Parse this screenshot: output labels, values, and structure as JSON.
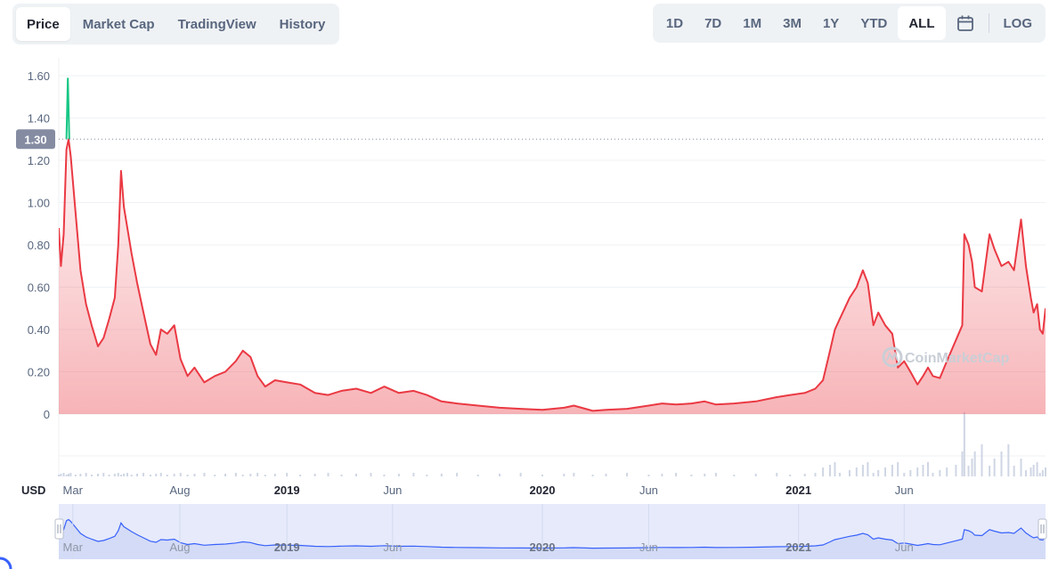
{
  "tabs": [
    {
      "label": "Price",
      "active": true
    },
    {
      "label": "Market Cap",
      "active": false
    },
    {
      "label": "TradingView",
      "active": false
    },
    {
      "label": "History",
      "active": false
    }
  ],
  "ranges": [
    {
      "label": "1D",
      "active": false
    },
    {
      "label": "7D",
      "active": false
    },
    {
      "label": "1M",
      "active": false
    },
    {
      "label": "3M",
      "active": false
    },
    {
      "label": "1Y",
      "active": false
    },
    {
      "label": "YTD",
      "active": false
    },
    {
      "label": "ALL",
      "active": true
    }
  ],
  "calendar_icon": "calendar-icon",
  "log_label": "LOG",
  "currency_label": "USD",
  "watermark": "CoinMarketCap",
  "colors": {
    "down": "#ea3943",
    "up": "#16c784",
    "navigator_line": "#3861fb",
    "navigator_fill": "#e6eafb",
    "volume": "#cfd6e4"
  },
  "chart_data": {
    "type": "area",
    "ylim": [
      0,
      1.7
    ],
    "yticks": [
      "0",
      "0.20",
      "0.40",
      "0.60",
      "0.80",
      "1.00",
      "1.20",
      "1.40",
      "1.60"
    ],
    "ytick_values": [
      0,
      0.2,
      0.4,
      0.6,
      0.8,
      1.0,
      1.2,
      1.4,
      1.6
    ],
    "current_price": 1.3,
    "current_price_label": "1.30",
    "xlim": [
      "2018-02-09",
      "2021-12-20"
    ],
    "xticks": [
      {
        "label": "Mar",
        "date": "2018-03-01",
        "bold": false
      },
      {
        "label": "Aug",
        "date": "2018-08-01",
        "bold": false
      },
      {
        "label": "2019",
        "date": "2019-01-01",
        "bold": true
      },
      {
        "label": "Jun",
        "date": "2019-06-01",
        "bold": false
      },
      {
        "label": "2020",
        "date": "2020-01-01",
        "bold": true
      },
      {
        "label": "Jun",
        "date": "2020-06-01",
        "bold": false
      },
      {
        "label": "2021",
        "date": "2021-01-01",
        "bold": true
      },
      {
        "label": "Jun",
        "date": "2021-06-01",
        "bold": false
      }
    ],
    "series": [
      {
        "points": [
          [
            "2018-02-09",
            0.88
          ],
          [
            "2018-02-12",
            0.7
          ],
          [
            "2018-02-16",
            0.85
          ],
          [
            "2018-02-20",
            1.25
          ],
          [
            "2018-02-23",
            1.3
          ],
          [
            "2018-02-26",
            1.22
          ],
          [
            "2018-03-05",
            0.95
          ],
          [
            "2018-03-12",
            0.68
          ],
          [
            "2018-03-20",
            0.52
          ],
          [
            "2018-03-28",
            0.42
          ],
          [
            "2018-04-06",
            0.32
          ],
          [
            "2018-04-14",
            0.36
          ],
          [
            "2018-04-22",
            0.45
          ],
          [
            "2018-04-30",
            0.55
          ],
          [
            "2018-05-05",
            0.8
          ],
          [
            "2018-05-09",
            1.15
          ],
          [
            "2018-05-13",
            0.98
          ],
          [
            "2018-05-18",
            0.88
          ],
          [
            "2018-05-24",
            0.76
          ],
          [
            "2018-06-01",
            0.62
          ],
          [
            "2018-06-10",
            0.48
          ],
          [
            "2018-06-20",
            0.33
          ],
          [
            "2018-06-28",
            0.28
          ],
          [
            "2018-07-05",
            0.4
          ],
          [
            "2018-07-14",
            0.38
          ],
          [
            "2018-07-24",
            0.42
          ],
          [
            "2018-08-02",
            0.26
          ],
          [
            "2018-08-12",
            0.18
          ],
          [
            "2018-08-22",
            0.22
          ],
          [
            "2018-09-05",
            0.15
          ],
          [
            "2018-09-20",
            0.18
          ],
          [
            "2018-10-05",
            0.2
          ],
          [
            "2018-10-20",
            0.25
          ],
          [
            "2018-10-30",
            0.3
          ],
          [
            "2018-11-10",
            0.27
          ],
          [
            "2018-11-20",
            0.18
          ],
          [
            "2018-12-01",
            0.13
          ],
          [
            "2018-12-15",
            0.16
          ],
          [
            "2019-01-01",
            0.15
          ],
          [
            "2019-01-20",
            0.14
          ],
          [
            "2019-02-10",
            0.1
          ],
          [
            "2019-03-01",
            0.09
          ],
          [
            "2019-03-20",
            0.11
          ],
          [
            "2019-04-10",
            0.12
          ],
          [
            "2019-05-01",
            0.1
          ],
          [
            "2019-05-20",
            0.13
          ],
          [
            "2019-06-10",
            0.1
          ],
          [
            "2019-07-01",
            0.11
          ],
          [
            "2019-07-20",
            0.09
          ],
          [
            "2019-08-10",
            0.06
          ],
          [
            "2019-09-01",
            0.05
          ],
          [
            "2019-10-01",
            0.04
          ],
          [
            "2019-11-01",
            0.03
          ],
          [
            "2019-12-01",
            0.025
          ],
          [
            "2020-01-01",
            0.02
          ],
          [
            "2020-02-01",
            0.03
          ],
          [
            "2020-02-15",
            0.04
          ],
          [
            "2020-03-13",
            0.015
          ],
          [
            "2020-04-01",
            0.02
          ],
          [
            "2020-05-01",
            0.025
          ],
          [
            "2020-06-01",
            0.04
          ],
          [
            "2020-06-20",
            0.05
          ],
          [
            "2020-07-10",
            0.045
          ],
          [
            "2020-08-01",
            0.05
          ],
          [
            "2020-08-20",
            0.06
          ],
          [
            "2020-09-05",
            0.045
          ],
          [
            "2020-10-01",
            0.05
          ],
          [
            "2020-11-01",
            0.06
          ],
          [
            "2020-12-01",
            0.08
          ],
          [
            "2020-12-20",
            0.09
          ],
          [
            "2021-01-10",
            0.1
          ],
          [
            "2021-01-25",
            0.12
          ],
          [
            "2021-02-05",
            0.16
          ],
          [
            "2021-02-15",
            0.3
          ],
          [
            "2021-02-22",
            0.4
          ],
          [
            "2021-03-01",
            0.45
          ],
          [
            "2021-03-15",
            0.55
          ],
          [
            "2021-03-25",
            0.6
          ],
          [
            "2021-04-03",
            0.68
          ],
          [
            "2021-04-10",
            0.62
          ],
          [
            "2021-04-18",
            0.42
          ],
          [
            "2021-04-25",
            0.48
          ],
          [
            "2021-05-05",
            0.42
          ],
          [
            "2021-05-15",
            0.38
          ],
          [
            "2021-05-23",
            0.22
          ],
          [
            "2021-06-01",
            0.25
          ],
          [
            "2021-06-10",
            0.2
          ],
          [
            "2021-06-20",
            0.14
          ],
          [
            "2021-06-28",
            0.18
          ],
          [
            "2021-07-05",
            0.22
          ],
          [
            "2021-07-12",
            0.18
          ],
          [
            "2021-07-22",
            0.17
          ],
          [
            "2021-08-01",
            0.25
          ],
          [
            "2021-08-14",
            0.35
          ],
          [
            "2021-08-23",
            0.42
          ],
          [
            "2021-08-26",
            0.85
          ],
          [
            "2021-09-01",
            0.8
          ],
          [
            "2021-09-06",
            0.72
          ],
          [
            "2021-09-10",
            0.6
          ],
          [
            "2021-09-20",
            0.58
          ],
          [
            "2021-10-01",
            0.85
          ],
          [
            "2021-10-08",
            0.78
          ],
          [
            "2021-10-18",
            0.7
          ],
          [
            "2021-10-28",
            0.72
          ],
          [
            "2021-11-05",
            0.68
          ],
          [
            "2021-11-15",
            0.92
          ],
          [
            "2021-11-22",
            0.7
          ],
          [
            "2021-11-29",
            0.55
          ],
          [
            "2021-12-03",
            0.48
          ],
          [
            "2021-12-08",
            0.52
          ],
          [
            "2021-12-12",
            0.4
          ],
          [
            "2021-12-16",
            0.38
          ],
          [
            "2021-12-20",
            0.5
          ]
        ]
      }
    ],
    "spike": [
      [
        "2018-02-20",
        1.3
      ],
      [
        "2018-02-22",
        1.59
      ],
      [
        "2018-02-24",
        1.3
      ]
    ]
  }
}
